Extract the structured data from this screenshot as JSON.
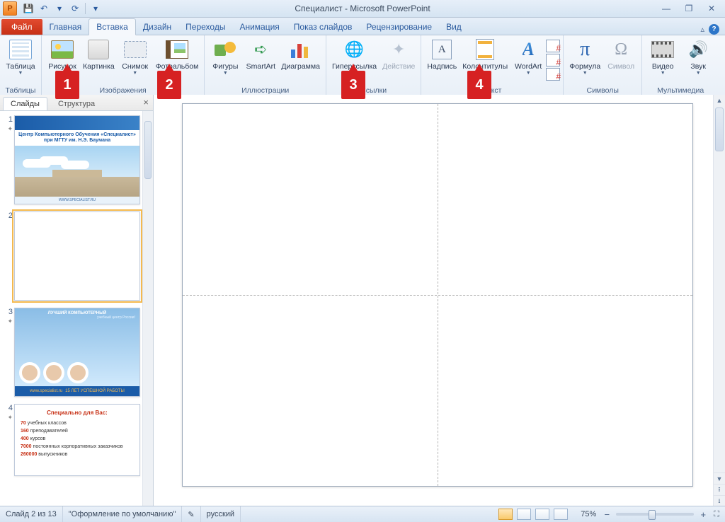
{
  "title": "Специалист - Microsoft PowerPoint",
  "qat": {
    "save": "💾",
    "undo": "↶",
    "redo": "↷",
    "repeat": "⟳"
  },
  "win": {
    "min": "—",
    "max": "❐",
    "close": "✕"
  },
  "tabs": {
    "file": "Файл",
    "items": [
      "Главная",
      "Вставка",
      "Дизайн",
      "Переходы",
      "Анимация",
      "Показ слайдов",
      "Рецензирование",
      "Вид"
    ],
    "active": 1,
    "minimize": "△"
  },
  "ribbon": {
    "groups": [
      {
        "label": "Таблицы",
        "buttons": [
          {
            "k": "table",
            "label": "Таблица",
            "dd": true
          }
        ]
      },
      {
        "label": "Изображения",
        "buttons": [
          {
            "k": "picture",
            "label": "Рисунок"
          },
          {
            "k": "clip",
            "label": "Картинка"
          },
          {
            "k": "screenshot",
            "label": "Снимок",
            "dd": true
          },
          {
            "k": "album",
            "label": "Фотоальбом",
            "dd": true
          }
        ]
      },
      {
        "label": "Иллюстрации",
        "buttons": [
          {
            "k": "shapes",
            "label": "Фигуры",
            "dd": true
          },
          {
            "k": "smartart",
            "label": "SmartArt"
          },
          {
            "k": "chart",
            "label": "Диаграмма"
          }
        ]
      },
      {
        "label": "Ссылки",
        "buttons": [
          {
            "k": "hyperlink",
            "label": "Гиперссылка"
          },
          {
            "k": "action",
            "label": "Действие",
            "disabled": true
          }
        ]
      },
      {
        "label": "Текст",
        "buttons": [
          {
            "k": "textbox",
            "label": "Надпись"
          },
          {
            "k": "headerfooter",
            "label": "Колонтитулы"
          },
          {
            "k": "wordart",
            "label": "WordArt",
            "dd": true
          },
          {
            "k": "datetime",
            "label": ""
          },
          {
            "k": "slidenum",
            "label": ""
          },
          {
            "k": "object",
            "label": ""
          }
        ]
      },
      {
        "label": "Символы",
        "buttons": [
          {
            "k": "equation",
            "label": "Формула",
            "dd": true
          },
          {
            "k": "symbol",
            "label": "Символ",
            "disabled": true
          }
        ]
      },
      {
        "label": "Мультимедиа",
        "buttons": [
          {
            "k": "video",
            "label": "Видео",
            "dd": true
          },
          {
            "k": "audio",
            "label": "Звук",
            "dd": true
          }
        ]
      }
    ]
  },
  "sidepanel": {
    "tab_slides": "Слайды",
    "tab_outline": "Структура",
    "s1": {
      "title": "Центр Компьютерного Обучения «Специалист»   при МГТУ им. Н.Э. Баумана",
      "footer": "WWW.SPECIALIST.RU"
    },
    "s3": {
      "top": "ЛУЧШИЙ КОМПЬЮТЕРНЫЙ",
      "sub": "учебный центр России!",
      "bandL": "www.specialist.ru",
      "bandR": "15 ЛЕТ УСПЕШНОЙ РАБОТЫ"
    },
    "s4": {
      "h": "Специально  для  Вас:",
      "l1n": "70",
      "l1": " учебных  классов",
      "l2n": "160",
      "l2": " преподавателей",
      "l3n": "400",
      "l3": " курсов",
      "l4n": "7000",
      "l4": " постоянных корпоративных  заказчиков",
      "l5n": "260000",
      "l5": " выпускников"
    }
  },
  "status": {
    "slide": "Слайд 2 из 13",
    "theme": "\"Оформление по умолчанию\"",
    "lang": "русский",
    "zoom": "75%"
  },
  "callouts": [
    "1",
    "2",
    "3",
    "4"
  ]
}
